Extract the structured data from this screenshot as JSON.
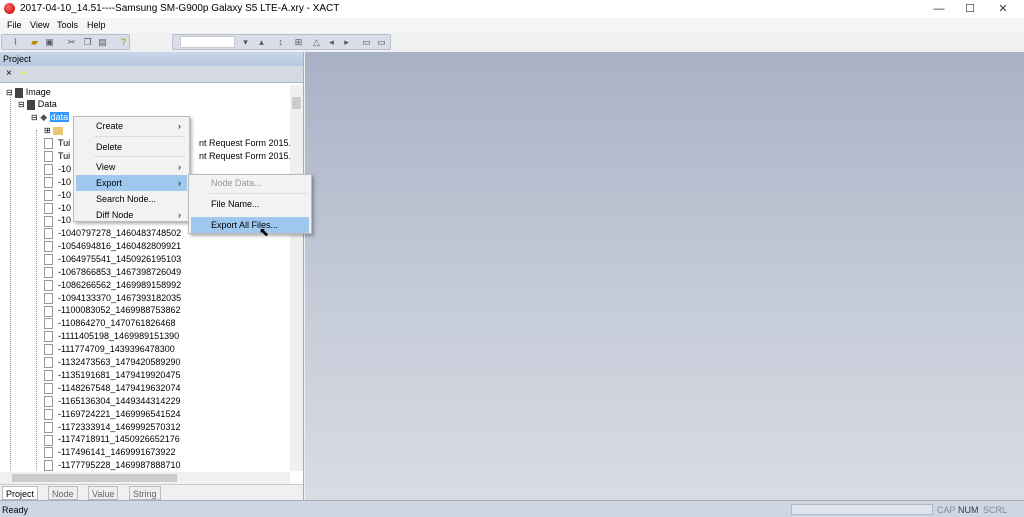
{
  "window": {
    "title": "2017-04-10_14.51----Samsung SM-G900p Galaxy S5 LTE-A.xry - XACT",
    "minimize": "—",
    "maximize": "☐",
    "close": "✕"
  },
  "menubar": [
    "File",
    "View",
    "Tools",
    "Help"
  ],
  "panel": {
    "title": "Project",
    "close": "×"
  },
  "tree": {
    "root": "Image",
    "data": "Data",
    "node": "data",
    "partial": [
      {
        "left": "Tui",
        "right": "nt Request Form 2015."
      },
      {
        "left": "Tui",
        "right": "nt Request Form 2015.docx"
      },
      {
        "left": "-10"
      },
      {
        "left": "-10"
      },
      {
        "left": "-10"
      },
      {
        "left": "-10"
      },
      {
        "left": "-10"
      }
    ],
    "files": [
      "-1040797278_1460483748502",
      "-1054694816_1460482809921",
      "-1064975541_1450926195103",
      "-1067866853_1467398726049",
      "-1086266562_1469989158992",
      "-1094133370_1467393182035",
      "-1100083052_1469988753862",
      "-110864270_1470761826468",
      "-1111405198_1469989151390",
      "-111774709_1439396478300",
      "-1132473563_1479420589290",
      "-1135191681_1479419920475",
      "-1148267548_1479419632074",
      "-1165136304_1449344314229",
      "-1169724221_1469996541524",
      "-1172333914_1469992570312",
      "-1174718911_1450926652176",
      "-117496141_1469991673922",
      "-1177795228_1469987888710"
    ]
  },
  "tabs": [
    "Project",
    "Node",
    "Value",
    "String"
  ],
  "context_menu": {
    "items": [
      {
        "label": "Create",
        "arrow": "›"
      },
      {
        "label": "Delete"
      },
      {
        "label": "View",
        "arrow": "›"
      },
      {
        "label": "Export",
        "arrow": "›",
        "highlighted": true
      },
      {
        "label": "Search Node..."
      },
      {
        "label": "Diff Node",
        "arrow": "›"
      }
    ]
  },
  "export_submenu": {
    "items": [
      {
        "label": "Node Data...",
        "disabled": true
      },
      {
        "label": "File Name..."
      },
      {
        "label": "Export All Files...",
        "highlighted": true
      }
    ]
  },
  "status": {
    "text": "Ready",
    "cap": "CAP",
    "num": "NUM",
    "scrl": "SCRL"
  },
  "colors": {
    "highlight": "#9fc8ef",
    "selected_node": "#3399ff",
    "workspace": "#b9c0d0"
  }
}
